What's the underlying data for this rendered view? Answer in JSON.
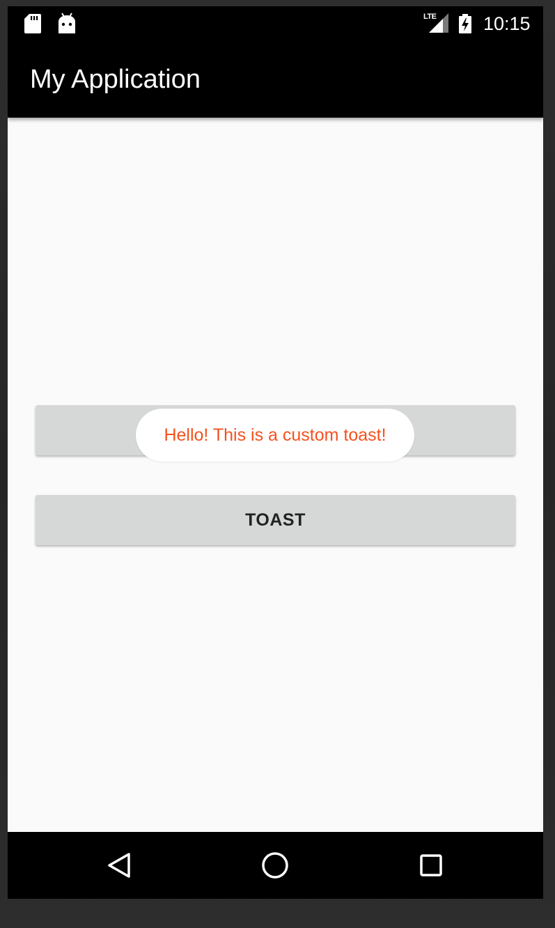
{
  "status_bar": {
    "time": "10:15",
    "network_label": "LTE",
    "icons": [
      "sd-card-icon",
      "android-icon",
      "lte-signal-icon",
      "battery-charging-icon"
    ]
  },
  "app_bar": {
    "title": "My Application"
  },
  "main": {
    "top_button_label": "",
    "toast_button_label": "TOAST"
  },
  "toast": {
    "message": "Hello! This is a custom toast!",
    "text_color": "#f4511e"
  },
  "nav_bar": {
    "icons": [
      "back-icon",
      "home-icon",
      "recents-icon"
    ]
  },
  "colors": {
    "bar_background": "#000000",
    "screen_background": "#fafafa",
    "button_background": "#d6d7d7"
  }
}
